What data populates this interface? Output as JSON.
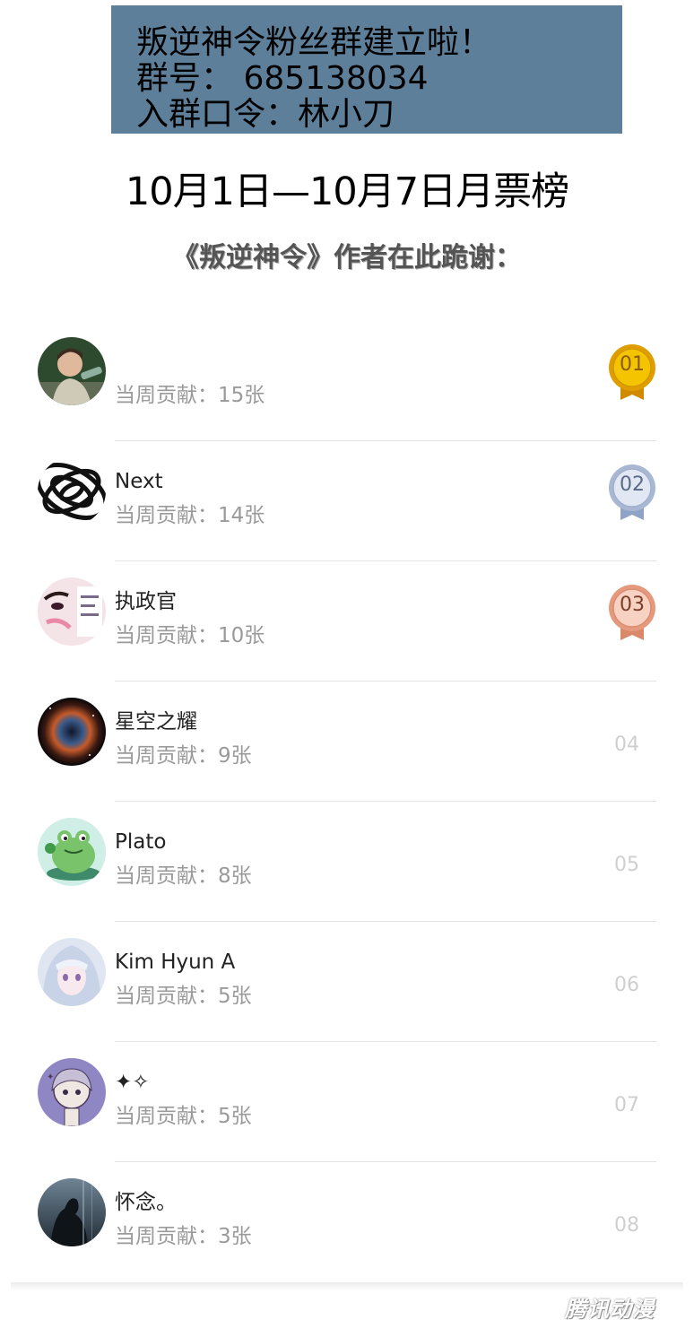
{
  "banner": {
    "line1": "叛逆神令粉丝群建立啦！",
    "line2": "群号： 685138034",
    "line3": "入群口令：林小刀"
  },
  "title": "10月1日—10月7日月票榜",
  "subtitle": "《叛逆神令》作者在此跪谢：",
  "contribution_label": "当周贡献：",
  "entries": [
    {
      "rank": "01",
      "name": "",
      "contribution": "当周贡献：15张",
      "medal": "gold"
    },
    {
      "rank": "02",
      "name": "Next",
      "contribution": "当周贡献：14张",
      "medal": "silver"
    },
    {
      "rank": "03",
      "name": "执政官",
      "contribution": "当周贡献：10张",
      "medal": "bronze"
    },
    {
      "rank": "04",
      "name": "星空之耀",
      "contribution": "当周贡献：9张",
      "medal": ""
    },
    {
      "rank": "05",
      "name": "Plato",
      "contribution": "当周贡献：8张",
      "medal": ""
    },
    {
      "rank": "06",
      "name": "Kim Hyun A",
      "contribution": "当周贡献：5张",
      "medal": ""
    },
    {
      "rank": "07",
      "name": "✦✧",
      "contribution": "当周贡献：5张",
      "medal": ""
    },
    {
      "rank": "08",
      "name": "怀念。",
      "contribution": "当周贡献：3张",
      "medal": ""
    }
  ],
  "watermark": "腾讯动漫",
  "colors": {
    "banner_bg": "#5e7f9a",
    "gold": "#f0b400",
    "silver": "#aebdd6",
    "bronze": "#e9a48a",
    "muted_text": "#9a9a9a"
  }
}
